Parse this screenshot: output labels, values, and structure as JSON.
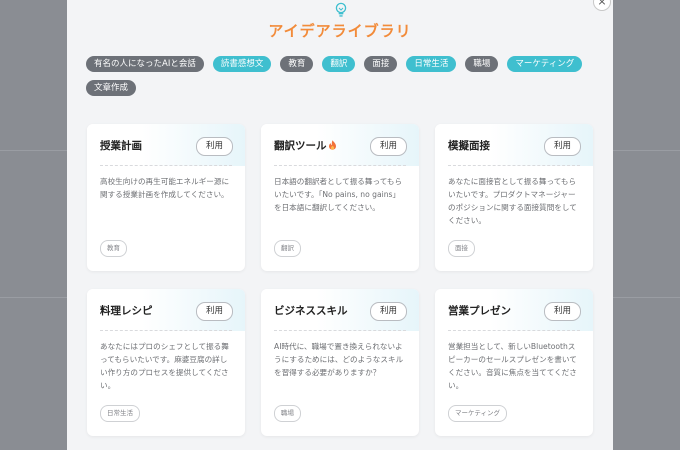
{
  "modal": {
    "title": "アイデアライブラリ",
    "close_label": "×",
    "icon": "lightbulb-icon"
  },
  "categories": [
    {
      "label": "有名の人になったAIと会話",
      "style": "dark"
    },
    {
      "label": "読書感想文",
      "style": "teal"
    },
    {
      "label": "教育",
      "style": "dark"
    },
    {
      "label": "翻訳",
      "style": "teal"
    },
    {
      "label": "面接",
      "style": "dark"
    },
    {
      "label": "日常生活",
      "style": "teal"
    },
    {
      "label": "職場",
      "style": "dark"
    },
    {
      "label": "マーケティング",
      "style": "teal"
    },
    {
      "label": "文章作成",
      "style": "dark"
    }
  ],
  "cards": [
    {
      "title": "授業計画",
      "use_label": "利用",
      "description": "高校生向けの再生可能エネルギー源に関する授業計画を作成してください。",
      "tag": "教育"
    },
    {
      "title": "翻訳ツール",
      "title_icon": "fire-icon",
      "use_label": "利用",
      "description": "日本語の翻訳者として振る舞ってもらいたいです。「No pains, no gains」を日本語に翻訳してください。",
      "tag": "翻訳"
    },
    {
      "title": "模擬面接",
      "use_label": "利用",
      "description": "あなたに面接官として振る舞ってもらいたいです。プロダクトマネージャーのポジションに関する面接質問をしてください。",
      "tag": "面接"
    },
    {
      "title": "料理レシピ",
      "use_label": "利用",
      "description": "あなたにはプロのシェフとして振る舞ってもらいたいです。麻婆豆腐の詳しい作り方のプロセスを提供してください。",
      "tag": "日常生活"
    },
    {
      "title": "ビジネススキル",
      "use_label": "利用",
      "description": "AI時代に、職場で置き換えられないようにするためには、どのようなスキルを習得する必要がありますか？",
      "tag": "職場"
    },
    {
      "title": "営業プレゼン",
      "use_label": "利用",
      "description": "営業担当として、新しいBluetoothスピーカーのセールスプレゼンを書いてください。音質に焦点を当ててください。",
      "tag": "マーケティング"
    }
  ],
  "colors": {
    "accent_orange": "#f28b3a",
    "tag_teal": "#3fbfcf",
    "tag_dark": "#6d7178",
    "backdrop": "#8a8d93"
  }
}
